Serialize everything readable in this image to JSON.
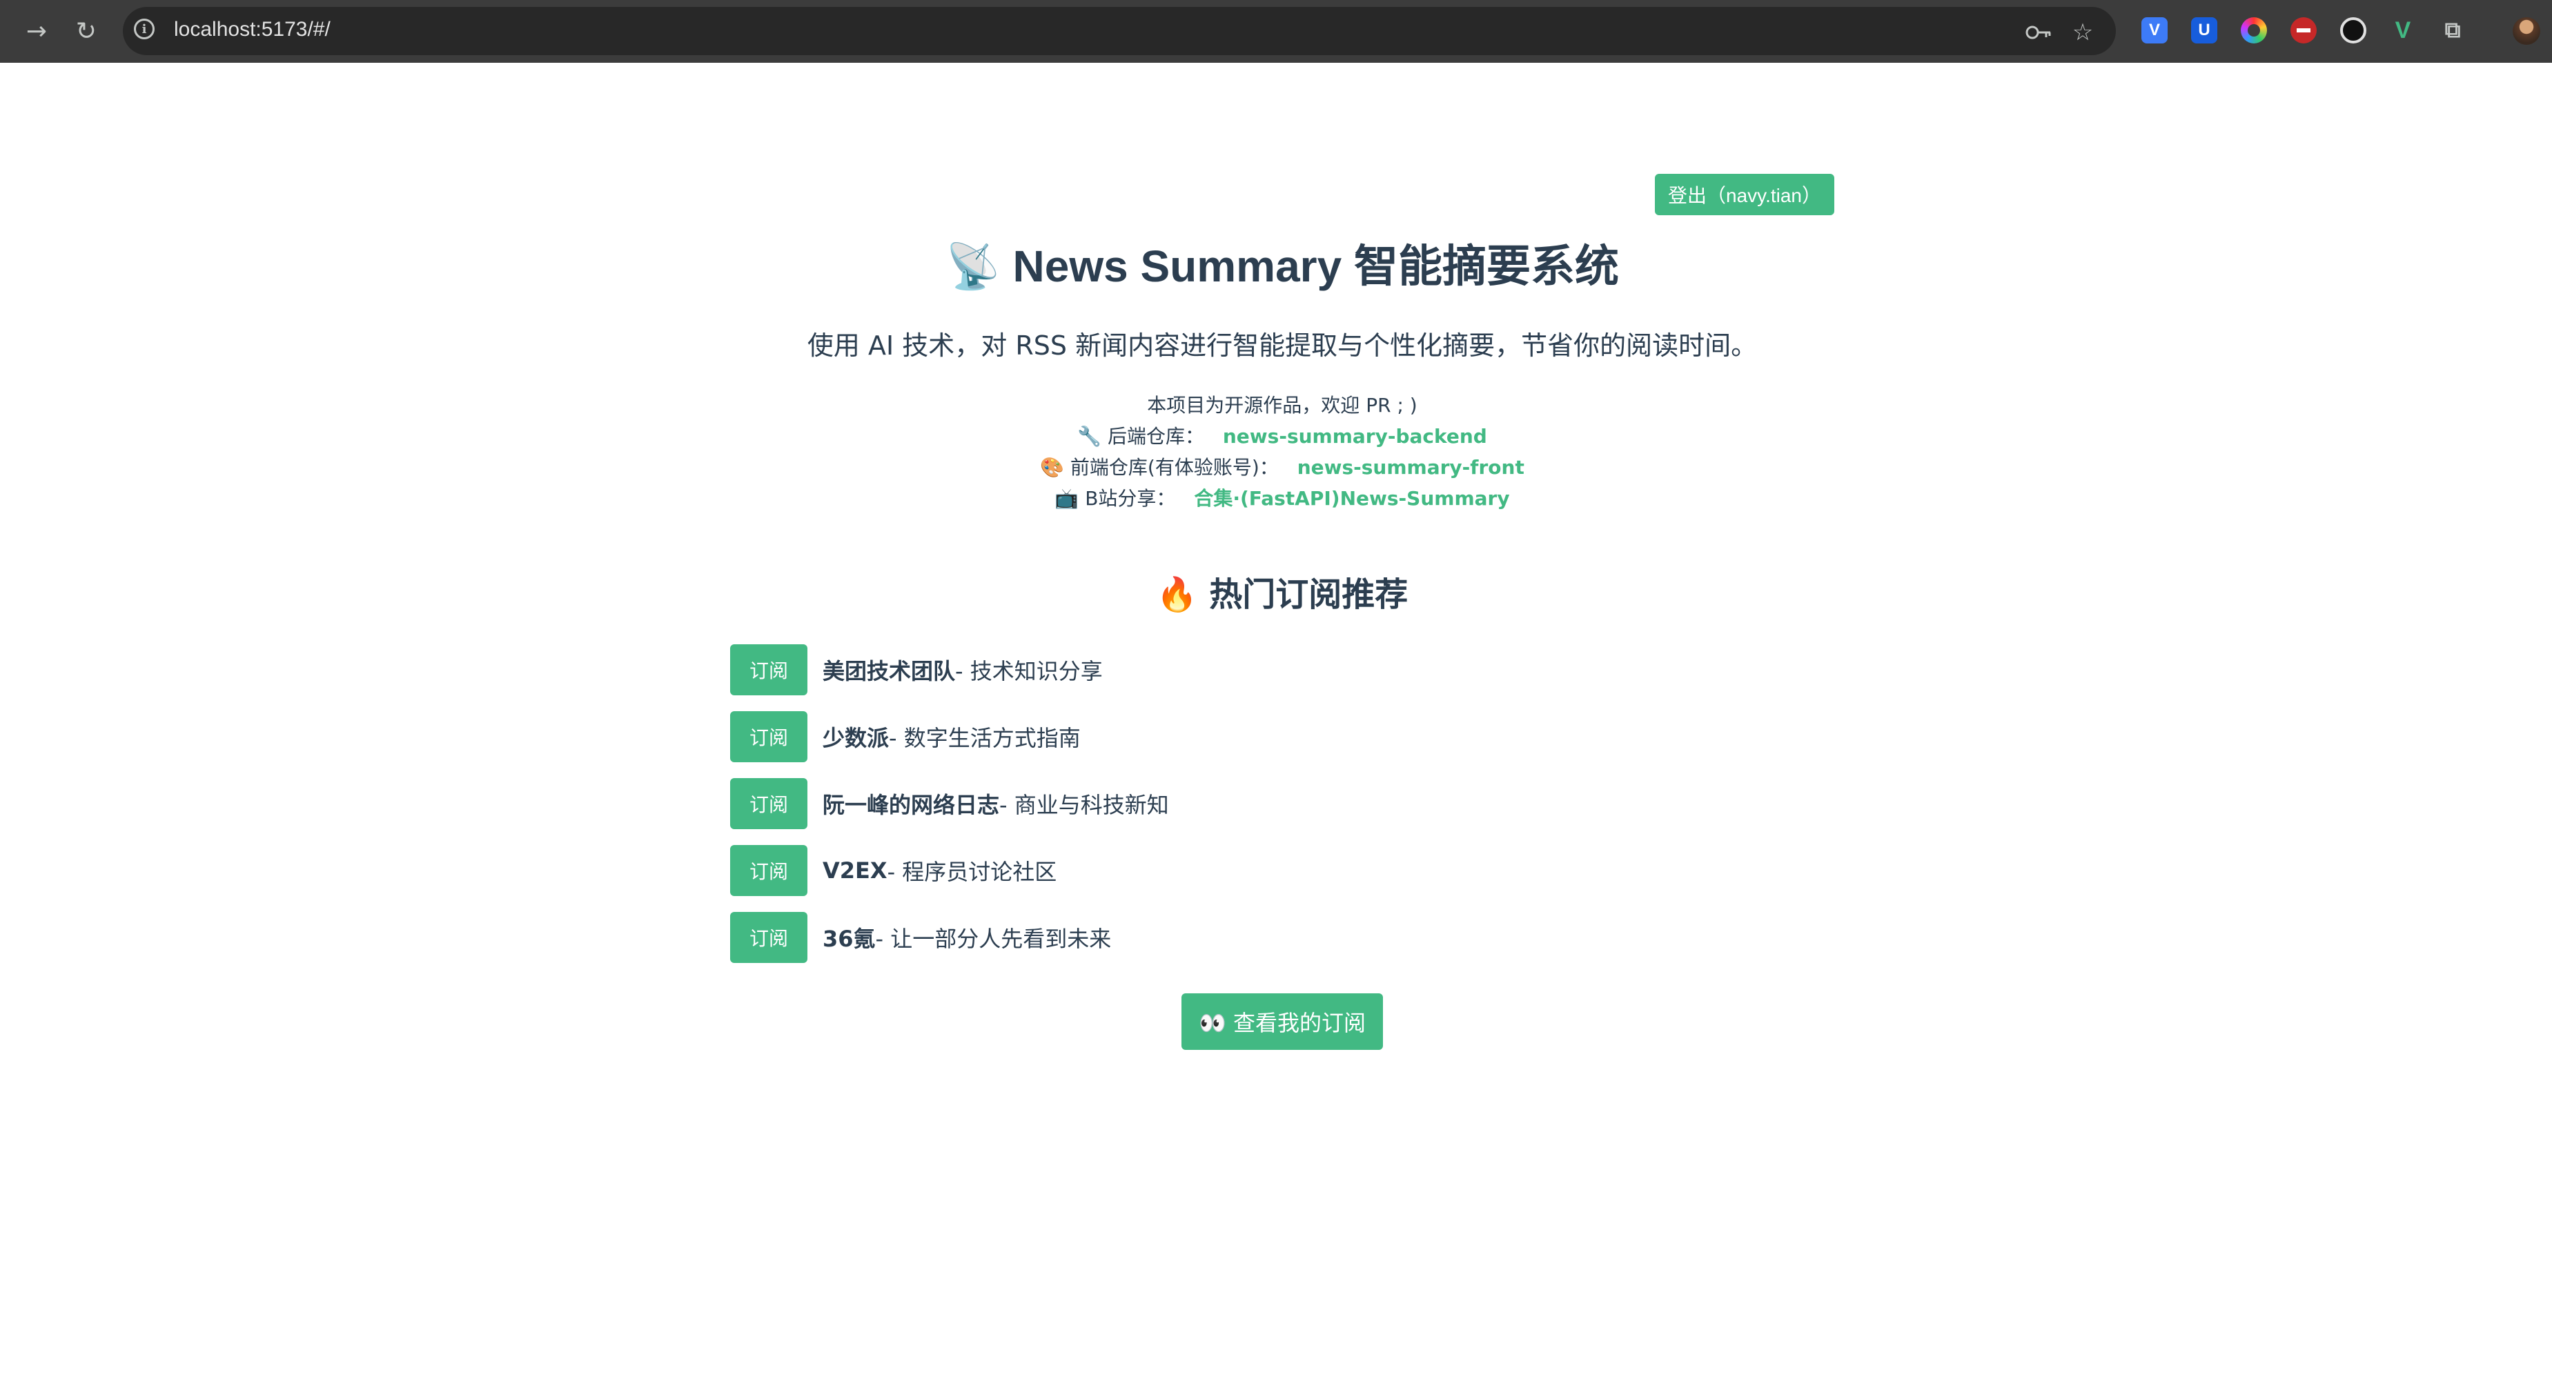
{
  "browser": {
    "url": "localhost:5173/#/",
    "extensions": [
      "vuetify-extension-icon",
      "bitwarden-extension-icon",
      "color-picker-extension-icon",
      "adblock-extension-icon",
      "dark-reader-extension-icon",
      "vue-devtools-extension-icon"
    ]
  },
  "header": {
    "logout_label": "登出（navy.tian）"
  },
  "hero": {
    "title_icon": "📡",
    "title": "News Summary 智能摘要系统",
    "subtitle": "使用 AI 技术，对 RSS 新闻内容进行智能提取与个性化摘要，节省你的阅读时间。"
  },
  "info": {
    "intro": "本项目为开源作品，欢迎 PR ; )",
    "backend_icon": "🔧",
    "backend_label": "后端仓库：",
    "backend_link": "news-summary-backend",
    "frontend_icon": "🎨",
    "frontend_label": "前端仓库(有体验账号)：",
    "frontend_link": "news-summary-front",
    "bilibili_icon": "📺",
    "bilibili_label": "B站分享：",
    "bilibili_link": "合集·(FastAPI)News-Summary"
  },
  "recommend": {
    "title_icon": "🔥",
    "title": "热门订阅推荐",
    "subscribe_label": "订阅",
    "feeds": [
      {
        "name": "美团技术团队",
        "desc": " - 技术知识分享"
      },
      {
        "name": "少数派",
        "desc": " - 数字生活方式指南"
      },
      {
        "name": "阮一峰的网络日志",
        "desc": " - 商业与科技新知"
      },
      {
        "name": "V2EX",
        "desc": " - 程序员讨论社区"
      },
      {
        "name": "36氪",
        "desc": " - 让一部分人先看到未来"
      }
    ]
  },
  "footer": {
    "my_subscriptions_label": "👀 查看我的订阅"
  },
  "colors": {
    "accent": "#42b983",
    "text": "#2c3e50",
    "chrome": "#3c3c3c"
  }
}
